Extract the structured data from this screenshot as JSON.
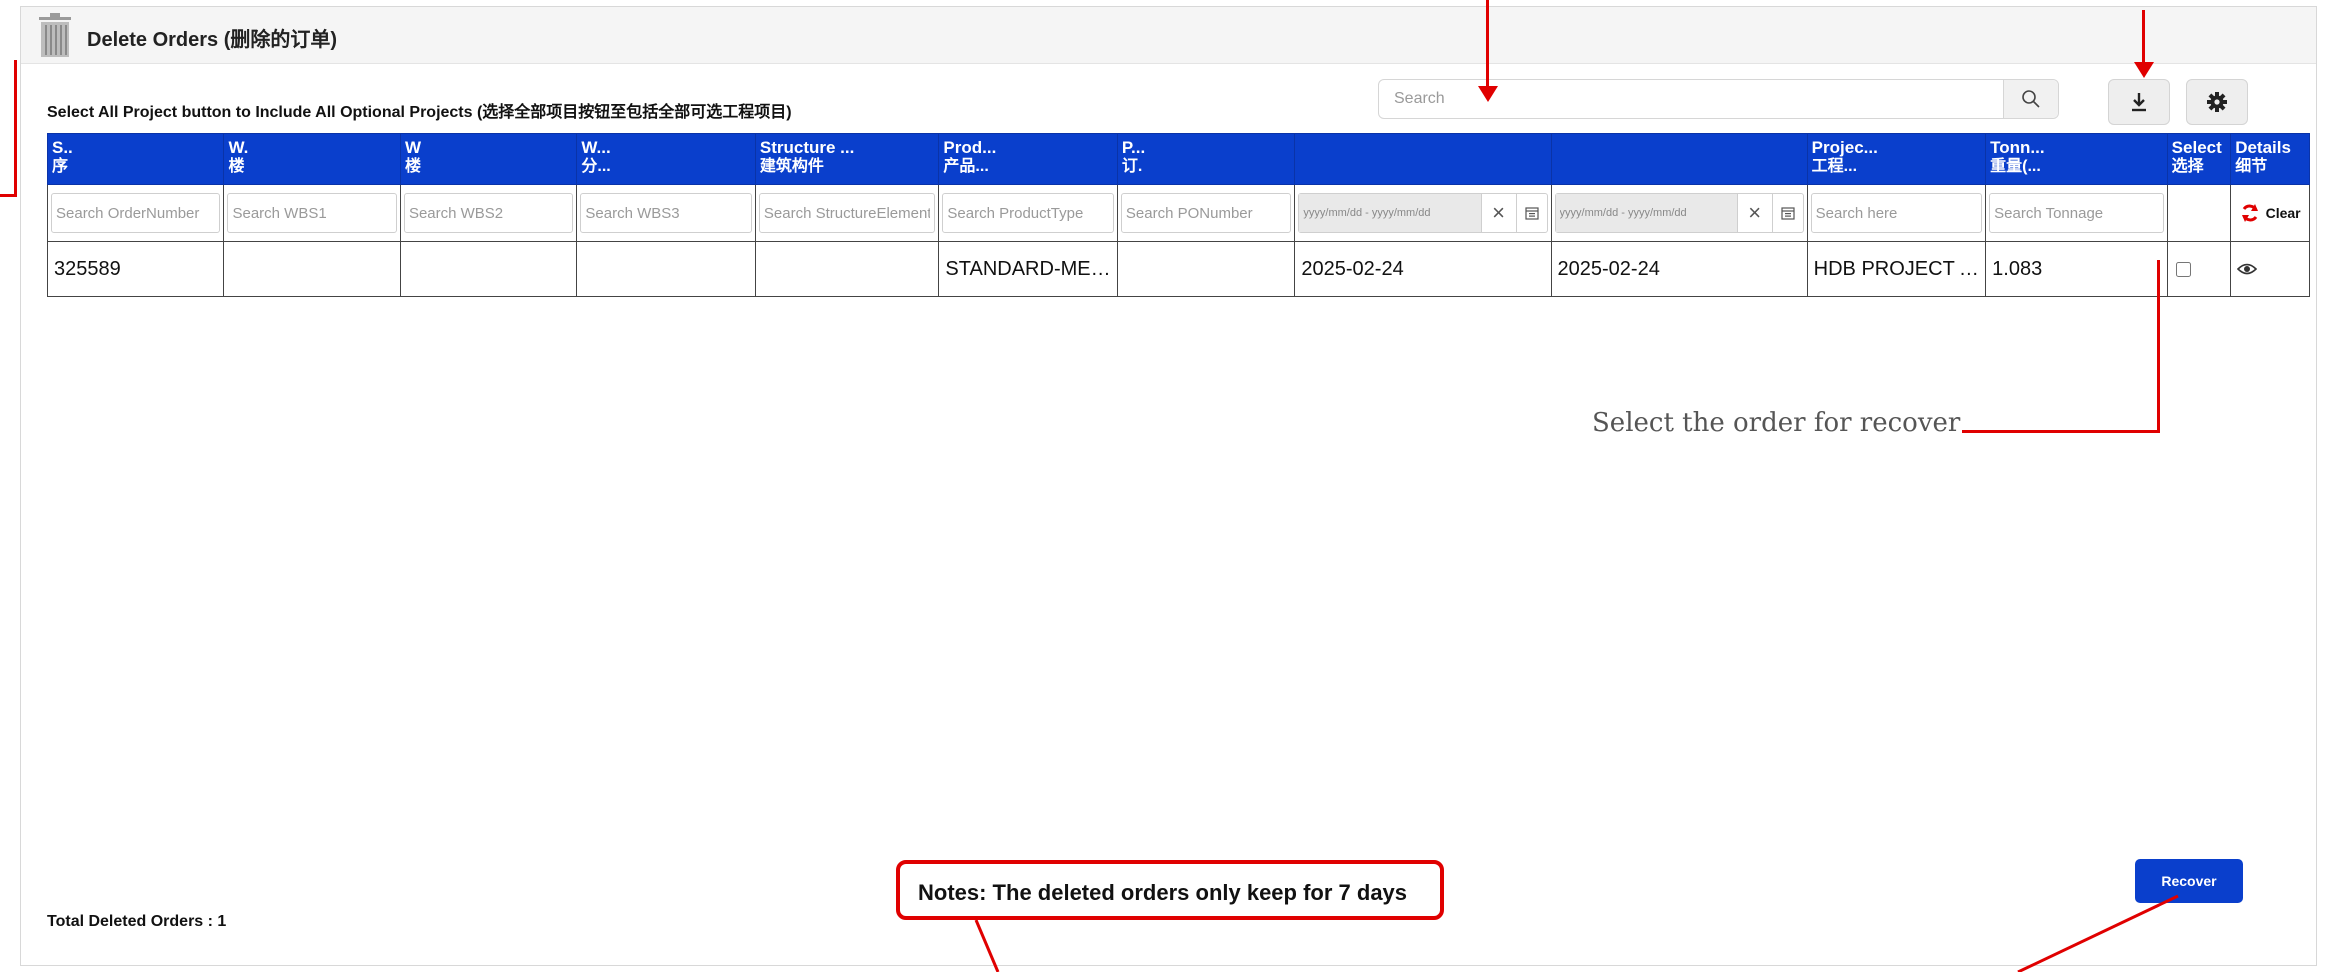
{
  "header": {
    "title": "Delete Orders (删除的订单)"
  },
  "instruction": "Select All Project button to Include All Optional Projects (选择全部项目按钮至包括全部可选工程项目)",
  "search": {
    "placeholder": "Search"
  },
  "columns": [
    {
      "en": "S..",
      "cn": "序"
    },
    {
      "en": "W.",
      "cn": "楼"
    },
    {
      "en": "W",
      "cn": "楼"
    },
    {
      "en": "W...",
      "cn": "分..."
    },
    {
      "en": "Structure ...",
      "cn": "建筑构件"
    },
    {
      "en": "Prod...",
      "cn": "产品..."
    },
    {
      "en": "P...",
      "cn": "订."
    },
    {
      "en": "",
      "cn": ""
    },
    {
      "en": "",
      "cn": ""
    },
    {
      "en": "Projec...",
      "cn": "工程..."
    },
    {
      "en": "Tonn...",
      "cn": "重量(..."
    },
    {
      "en": "Select",
      "cn": "选择"
    },
    {
      "en": "Details",
      "cn": "细节"
    }
  ],
  "filters": {
    "order_number": "Search OrderNumber",
    "wbs1": "Search WBS1",
    "wbs2": "Search WBS2",
    "wbs3": "Search WBS3",
    "structure": "Search StructureElement",
    "product": "Search ProductType",
    "po": "Search PONumber",
    "date1": "yyyy/mm/dd - yyyy/mm/dd",
    "date2": "yyyy/mm/dd - yyyy/mm/dd",
    "project": "Search here",
    "tonnage": "Search Tonnage",
    "clear_label": "Clear"
  },
  "rows": [
    {
      "order_number": "325589",
      "wbs1": "",
      "wbs2": "",
      "wbs3": "",
      "structure": "",
      "product": "STANDARD-MESH",
      "po": "",
      "date1": "2025-02-24",
      "date2": "2025-02-24",
      "project": "HDB PROJECT A...",
      "tonnage": "1.083",
      "selected": false
    }
  ],
  "annotation": {
    "select_hint": "Select the order for recover"
  },
  "notes": "Notes: The deleted orders only keep for 7 days",
  "footer": {
    "total": "Total Deleted Orders : 1"
  },
  "buttons": {
    "recover": "Recover"
  },
  "colors": {
    "header_blue": "#0a3fcc",
    "annotation_red": "#e00000"
  }
}
